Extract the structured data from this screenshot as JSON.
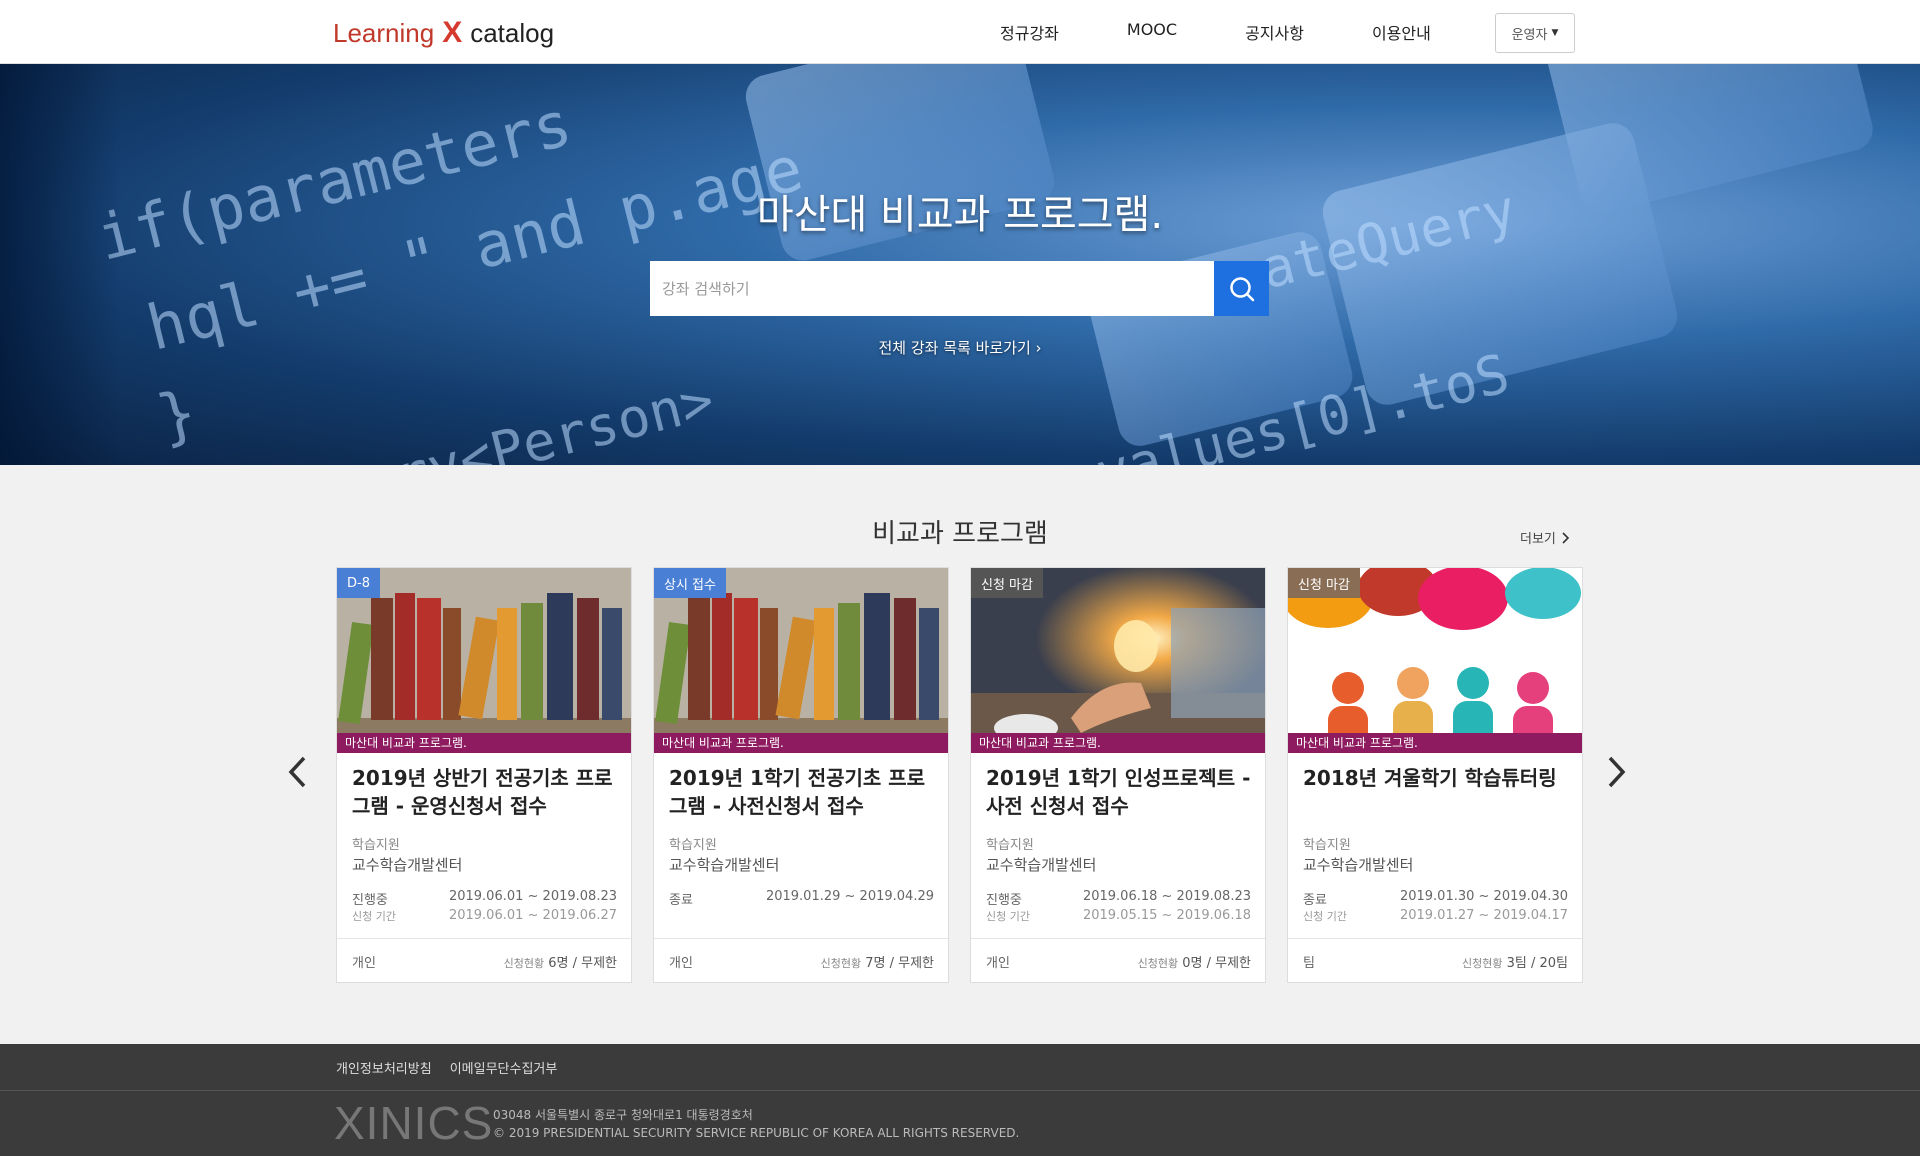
{
  "header": {
    "logo_part1": "Learning",
    "logo_x": "X",
    "logo_part2": "catalog",
    "nav": [
      "정규강좌",
      "MOOC",
      "공지사항",
      "이용안내"
    ],
    "role_button": "운영자"
  },
  "hero": {
    "title": "마산대 비교과 프로그램.",
    "search_placeholder": "강좌 검색하기",
    "all_courses_link": "전체 강좌 목록 바로가기 ›"
  },
  "section": {
    "title": "비교과 프로그램",
    "more": "더보기"
  },
  "cards": [
    {
      "badge": "D-8",
      "badge_color": "#4a7fd6",
      "ribbon": "마산대 비교과 프로그램.",
      "image": "books-image",
      "title": "2019년 상반기 전공기초 프로그램 - 운영신청서 접수",
      "category": "학습지원",
      "org": "교수학습개발센터",
      "status": "진행중",
      "period_label": "신청 기간",
      "date1": "2019.06.01 ~ 2019.08.23",
      "date2": "2019.06.01 ~ 2019.06.27",
      "type": "개인",
      "apply_label": "신청현황",
      "apply_value": "6명 / 무제한"
    },
    {
      "badge": "상시 접수",
      "badge_color": "#4a7fd6",
      "ribbon": "마산대 비교과 프로그램.",
      "image": "books-image",
      "title": "2019년 1학기 전공기초 프로그램 - 사전신청서 접수",
      "category": "학습지원",
      "org": "교수학습개발센터",
      "status": "종료",
      "period_label": "",
      "date1": "2019.01.29 ~ 2019.04.29",
      "date2": "",
      "type": "개인",
      "apply_label": "신청현황",
      "apply_value": "7명 / 무제한"
    },
    {
      "badge": "신청 마감",
      "badge_color": "#555555",
      "ribbon": "마산대 비교과 프로그램.",
      "image": "lightbulb-image",
      "title": "2019년 1학기 인성프로젝트 - 사전 신청서 접수",
      "category": "학습지원",
      "org": "교수학습개발센터",
      "status": "진행중",
      "period_label": "신청 기간",
      "date1": "2019.06.18 ~ 2019.08.23",
      "date2": "2019.05.15 ~ 2019.06.18",
      "type": "개인",
      "apply_label": "신청현황",
      "apply_value": "0명 / 무제한"
    },
    {
      "badge": "신청 마감",
      "badge_color": "#8a6d55",
      "ribbon": "마산대 비교과 프로그램.",
      "image": "speech-bubbles-image",
      "title": "2018년 겨울학기 학습튜터링",
      "category": "학습지원",
      "org": "교수학습개발센터",
      "status": "종료",
      "period_label": "신청 기간",
      "date1": "2019.01.30 ~ 2019.04.30",
      "date2": "2019.01.27 ~ 2019.04.17",
      "type": "팀",
      "apply_label": "신청현황",
      "apply_value": "3팀 / 20팀"
    }
  ],
  "footer": {
    "links": [
      "개인정보처리방침",
      "이메일무단수집거부"
    ],
    "logo": "XINICS",
    "address": "03048 서울특별시 종로구 청와대로1 대통령경호처",
    "copyright": "© 2019 PRESIDENTIAL SECURITY SERVICE REPUBLIC OF KOREA ALL RIGHTS RESERVED."
  },
  "colors": {
    "accent": "#1e6fe0",
    "ribbon": "#8e1b5f",
    "footer_bg": "#3b3b3b"
  }
}
